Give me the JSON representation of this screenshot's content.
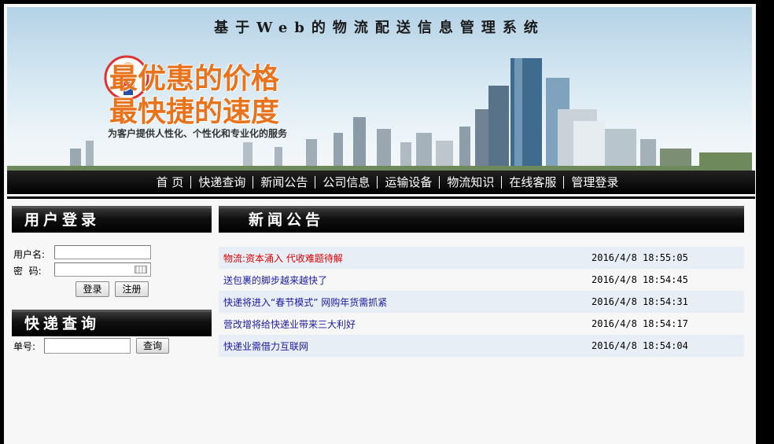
{
  "banner": {
    "title": "基于Web的物流配送信息管理系统",
    "slogan_line1": "最优惠的价格",
    "slogan_line2": "最快捷的速度",
    "slogan_line3": "为客户提供人性化、个性化和专业化的服务"
  },
  "nav": {
    "items": [
      {
        "label": "首 页"
      },
      {
        "label": "快递查询"
      },
      {
        "label": "新闻公告"
      },
      {
        "label": "公司信息"
      },
      {
        "label": "运输设备"
      },
      {
        "label": "物流知识"
      },
      {
        "label": "在线客服"
      },
      {
        "label": "管理登录"
      }
    ]
  },
  "login": {
    "heading": "用户登录",
    "username_label": "用户名:",
    "password_label": "密  码:",
    "login_button": "登录",
    "register_button": "注册"
  },
  "express": {
    "heading": "快递查询",
    "number_label": "单号:",
    "query_button": "查询"
  },
  "news": {
    "heading": "新闻公告",
    "items": [
      {
        "title": "物流:资本涌入 代收难题待解",
        "time": "2016/4/8 18:55:05"
      },
      {
        "title": "送包裹的脚步越来越快了",
        "time": "2016/4/8 18:54:45"
      },
      {
        "title": "快递将进入“春节模式” 网购年货需抓紧",
        "time": "2016/4/8 18:54:31"
      },
      {
        "title": "营改增将给快递业带来三大利好",
        "time": "2016/4/8 18:54:17"
      },
      {
        "title": "快递业需借力互联网",
        "time": "2016/4/8 18:54:04"
      }
    ]
  },
  "colors": {
    "slogan": "#e8731d",
    "news_highlight": "#dd0000",
    "news_link": "#1a1aa0",
    "row_alt": "#e8eef6"
  }
}
